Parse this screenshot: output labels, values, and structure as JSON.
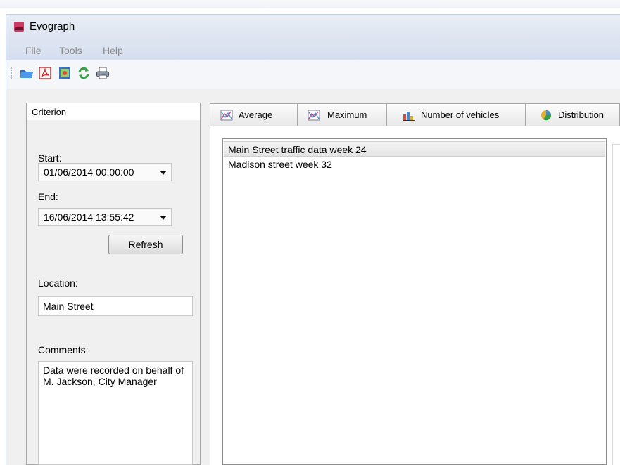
{
  "window": {
    "title": "Evograph",
    "icon": "evograph-app-icon"
  },
  "menu": {
    "items": [
      "File",
      "Tools",
      "Help"
    ]
  },
  "toolbar": {
    "buttons": [
      "open-folder-icon",
      "pdf-icon",
      "image-export-icon",
      "refresh-icon",
      "print-icon"
    ]
  },
  "criterion": {
    "header": "Criterion",
    "start_label": "Start:",
    "start_value": "01/06/2014 00:00:00",
    "end_label": "End:",
    "end_value": "16/06/2014 13:55:42",
    "refresh_label": "Refresh",
    "location_label": "Location:",
    "location_value": "Main Street",
    "comments_label": "Comments:",
    "comments_value": "Data were recorded on behalf of M. Jackson, City Manager"
  },
  "tabs": [
    {
      "label": "Average",
      "icon": "line-chart-icon"
    },
    {
      "label": "Maximum",
      "icon": "line-chart-icon"
    },
    {
      "label": "Number of vehicles",
      "icon": "bar-chart-icon"
    },
    {
      "label": "Distribution",
      "icon": "pie-chart-icon"
    }
  ],
  "datasets": [
    "Main Street traffic data week 24",
    "Madison street week 32"
  ],
  "selected_dataset": "Main Street traffic data week 24"
}
